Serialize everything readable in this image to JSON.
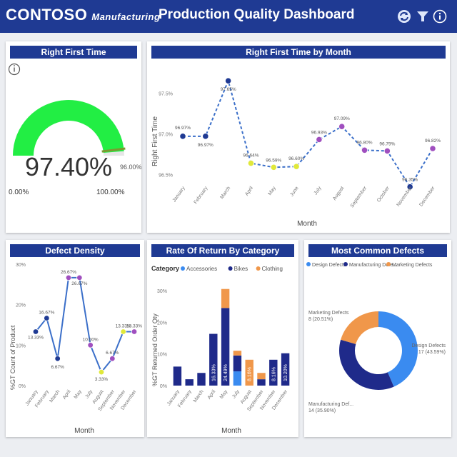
{
  "header": {
    "brand": "CONTOSO",
    "brand_sub": "Manufacturing",
    "title": "Production Quality Dashboard",
    "icons": [
      "refresh-icon",
      "filter-icon",
      "info-icon"
    ]
  },
  "colors": {
    "header_bg": "#1f3a93",
    "gauge_fill": "#22ee44",
    "line": "#3b6fc9",
    "dot_blue": "#1f3a93",
    "dot_purple": "#a04fbf",
    "dot_yellow": "#e0e83a",
    "bar_navy": "#1f2a8a",
    "bar_orange": "#f0974a",
    "bar_lightblue": "#3a8bf0"
  },
  "gauge": {
    "title": "Right First Time",
    "value_label": "97.40%",
    "value": 97.4,
    "min_label": "0.00%",
    "max_label": "100.00%",
    "target_label": "96.00%",
    "target": 96.0
  },
  "rft_month": {
    "title": "Right First Time by Month",
    "ylabel": "Right First Time",
    "xlabel": "Month"
  },
  "defect_density": {
    "title": "Defect Density",
    "ylabel": "%GT Count of Product",
    "xlabel": "Month"
  },
  "rate_of_return": {
    "title": "Rate Of Return By Category",
    "legend_title": "Category",
    "ylabel": "%GT Returned Order Qty",
    "xlabel": "Month"
  },
  "common_defects": {
    "title": "Most Common Defects"
  },
  "chart_data": [
    {
      "type": "line",
      "title": "Right First Time by Month",
      "xlabel": "Month",
      "ylabel": "Right First Time",
      "categories": [
        "January",
        "February",
        "March",
        "April",
        "May",
        "June",
        "July",
        "August",
        "September",
        "October",
        "November",
        "December"
      ],
      "values": [
        96.97,
        96.97,
        97.65,
        96.64,
        96.59,
        96.6,
        96.93,
        97.09,
        96.8,
        96.79,
        96.35,
        96.82
      ],
      "labels": [
        "96.97%",
        "96.97%",
        "97.65%",
        "96.64%",
        "96.59%",
        "96.60%",
        "96.93%",
        "97.09%",
        "96.80%",
        "96.79%",
        "96.35%",
        "96.82%"
      ],
      "point_colors": [
        "blue",
        "blue",
        "blue",
        "yellow",
        "yellow",
        "yellow",
        "purple",
        "purple",
        "purple",
        "purple",
        "blue",
        "purple"
      ],
      "yticks": [
        "97.5%",
        "97.0%",
        "96.5%"
      ],
      "ylim": [
        96.4,
        97.8
      ]
    },
    {
      "type": "line",
      "title": "Defect Density",
      "xlabel": "Month",
      "ylabel": "%GT Count of Product",
      "categories": [
        "January",
        "February",
        "March",
        "April",
        "May",
        "July",
        "August",
        "September",
        "November",
        "December"
      ],
      "values": [
        13.33,
        16.67,
        6.67,
        26.67,
        26.67,
        10.0,
        3.33,
        6.67,
        13.33,
        13.33
      ],
      "labels": [
        "13.33%",
        "16.67%",
        "6.67%",
        "26.67%",
        "26.67%",
        "10.00%",
        "3.33%",
        "6.67%",
        "13.33%",
        "13.33%"
      ],
      "point_colors": [
        "blue",
        "blue",
        "blue",
        "purple",
        "purple",
        "purple",
        "yellow",
        "purple",
        "yellow",
        "purple"
      ],
      "yticks": [
        "30%",
        "20%",
        "10%",
        "0%"
      ],
      "ylim": [
        0,
        30
      ]
    },
    {
      "type": "bar",
      "title": "Rate Of Return By Category",
      "xlabel": "Month",
      "ylabel": "%GT Returned Order Qty",
      "legend": [
        "Accessories",
        "Bikes",
        "Clothing"
      ],
      "categories": [
        "January",
        "February",
        "March",
        "April",
        "May",
        "July",
        "August",
        "September",
        "November",
        "December"
      ],
      "series": [
        {
          "name": "Accessories",
          "values": [
            0,
            0,
            0,
            0,
            0,
            4.5,
            0,
            0,
            0,
            0
          ]
        },
        {
          "name": "Bikes",
          "values": [
            6.0,
            2.0,
            4.0,
            16.33,
            24.49,
            5.0,
            0,
            2.0,
            8.16,
            10.2
          ]
        },
        {
          "name": "Clothing",
          "values": [
            0,
            0,
            0,
            0,
            6.0,
            1.5,
            8.16,
            2.0,
            0,
            0
          ]
        }
      ],
      "bar_labels": [
        "",
        "",
        "",
        "16.33%",
        "24.49%",
        "",
        "8.16%",
        "",
        "8.16%",
        "10.20%"
      ],
      "yticks": [
        "30%",
        "20%",
        "10%",
        "0%"
      ],
      "ylim": [
        0,
        32
      ]
    },
    {
      "type": "pie",
      "title": "Most Common Defects",
      "legend": [
        "Design Defects",
        "Manufacturing Defe...",
        "Marketing Defects"
      ],
      "labels": [
        "Design Defects",
        "Manufacturing Def...",
        "Marketing Defects"
      ],
      "values": [
        17,
        14,
        8
      ],
      "value_labels": [
        "17 (43.59%)",
        "14 (35.90%)",
        "8 (20.51%)"
      ]
    }
  ]
}
